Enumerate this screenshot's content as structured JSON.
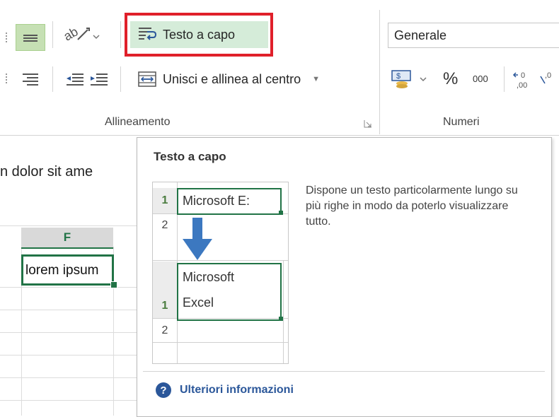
{
  "ribbon": {
    "wrap_text_label": "Testo a capo",
    "merge_label": "Unisci e allinea al centro",
    "number_format": "Generale",
    "percent_symbol": "%",
    "thousands_label": "000",
    "alignment_group": "Allineamento",
    "number_group": "Numeri"
  },
  "sheet": {
    "cell_text_above": "n dolor sit ame",
    "column_f_header": "F",
    "active_cell_text": "lorem ipsum"
  },
  "tooltip": {
    "title": "Testo a capo",
    "description": "Dispone un testo particolarmente lungo su più righe in modo da poterlo visualizzare tutto.",
    "illus_row1": "1",
    "illus_row2": "2",
    "illus_before_text": "Microsoft E:",
    "illus_after_line1": "Microsoft",
    "illus_after_line2": "Excel",
    "more_info": "Ulteriori informazioni"
  },
  "colors": {
    "accent_green": "#217346",
    "highlight_red": "#e0202a",
    "link_blue": "#2b579a",
    "button_active_bg": "#d5ecd9"
  }
}
